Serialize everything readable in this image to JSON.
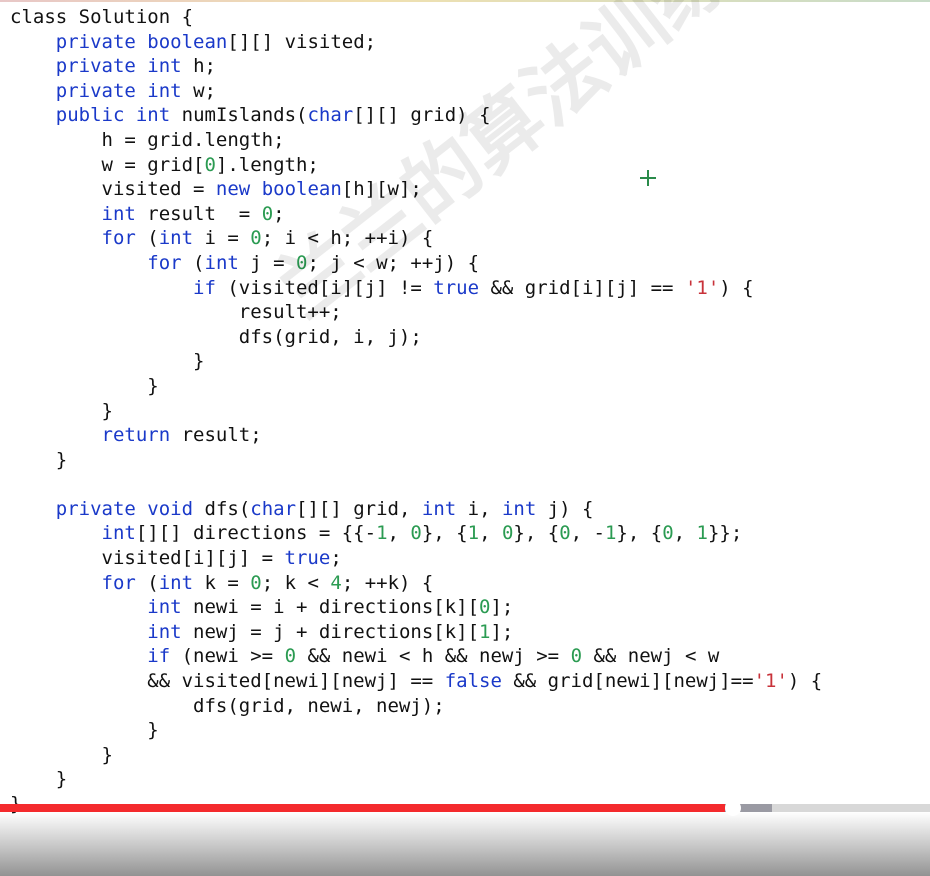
{
  "code_lines": [
    [
      {
        "t": "class Solution {",
        "c": "pl"
      }
    ],
    [
      {
        "t": "    ",
        "c": "pl"
      },
      {
        "t": "private",
        "c": "kw"
      },
      {
        "t": " ",
        "c": "pl"
      },
      {
        "t": "boolean",
        "c": "kw"
      },
      {
        "t": "[][] visited;",
        "c": "pl"
      }
    ],
    [
      {
        "t": "    ",
        "c": "pl"
      },
      {
        "t": "private",
        "c": "kw"
      },
      {
        "t": " ",
        "c": "pl"
      },
      {
        "t": "int",
        "c": "kw"
      },
      {
        "t": " h;",
        "c": "pl"
      }
    ],
    [
      {
        "t": "    ",
        "c": "pl"
      },
      {
        "t": "private",
        "c": "kw"
      },
      {
        "t": " ",
        "c": "pl"
      },
      {
        "t": "int",
        "c": "kw"
      },
      {
        "t": " w;",
        "c": "pl"
      }
    ],
    [
      {
        "t": "    ",
        "c": "pl"
      },
      {
        "t": "public",
        "c": "kw"
      },
      {
        "t": " ",
        "c": "pl"
      },
      {
        "t": "int",
        "c": "kw"
      },
      {
        "t": " numIslands(",
        "c": "pl"
      },
      {
        "t": "char",
        "c": "kw"
      },
      {
        "t": "[][] grid) {",
        "c": "pl"
      }
    ],
    [
      {
        "t": "        h = grid.length;",
        "c": "pl"
      }
    ],
    [
      {
        "t": "        w = grid[",
        "c": "pl"
      },
      {
        "t": "0",
        "c": "num"
      },
      {
        "t": "].length;",
        "c": "pl"
      }
    ],
    [
      {
        "t": "        visited = ",
        "c": "pl"
      },
      {
        "t": "new",
        "c": "kw"
      },
      {
        "t": " ",
        "c": "pl"
      },
      {
        "t": "boolean",
        "c": "kw"
      },
      {
        "t": "[h][w];",
        "c": "pl"
      }
    ],
    [
      {
        "t": "        ",
        "c": "pl"
      },
      {
        "t": "int",
        "c": "kw"
      },
      {
        "t": " result  = ",
        "c": "pl"
      },
      {
        "t": "0",
        "c": "num"
      },
      {
        "t": ";",
        "c": "pl"
      }
    ],
    [
      {
        "t": "        ",
        "c": "pl"
      },
      {
        "t": "for",
        "c": "kw"
      },
      {
        "t": " (",
        "c": "pl"
      },
      {
        "t": "int",
        "c": "kw"
      },
      {
        "t": " i = ",
        "c": "pl"
      },
      {
        "t": "0",
        "c": "num"
      },
      {
        "t": "; i < h; ++i) {",
        "c": "pl"
      }
    ],
    [
      {
        "t": "            ",
        "c": "pl"
      },
      {
        "t": "for",
        "c": "kw"
      },
      {
        "t": " (",
        "c": "pl"
      },
      {
        "t": "int",
        "c": "kw"
      },
      {
        "t": " j = ",
        "c": "pl"
      },
      {
        "t": "0",
        "c": "num"
      },
      {
        "t": "; j < w; ++j) {",
        "c": "pl"
      }
    ],
    [
      {
        "t": "                ",
        "c": "pl"
      },
      {
        "t": "if",
        "c": "kw"
      },
      {
        "t": " (visited[i][j] != ",
        "c": "pl"
      },
      {
        "t": "true",
        "c": "kw"
      },
      {
        "t": " && grid[i][j] == ",
        "c": "pl"
      },
      {
        "t": "'1'",
        "c": "str"
      },
      {
        "t": ") {",
        "c": "pl"
      }
    ],
    [
      {
        "t": "                    result++;",
        "c": "pl"
      }
    ],
    [
      {
        "t": "                    dfs(grid, i, j);",
        "c": "pl"
      }
    ],
    [
      {
        "t": "                }",
        "c": "pl"
      }
    ],
    [
      {
        "t": "            }",
        "c": "pl"
      }
    ],
    [
      {
        "t": "        }",
        "c": "pl"
      }
    ],
    [
      {
        "t": "        ",
        "c": "pl"
      },
      {
        "t": "return",
        "c": "kw"
      },
      {
        "t": " result;",
        "c": "pl"
      }
    ],
    [
      {
        "t": "    }",
        "c": "pl"
      }
    ],
    [
      {
        "t": "",
        "c": "pl"
      }
    ],
    [
      {
        "t": "    ",
        "c": "pl"
      },
      {
        "t": "private",
        "c": "kw"
      },
      {
        "t": " ",
        "c": "pl"
      },
      {
        "t": "void",
        "c": "kw"
      },
      {
        "t": " dfs(",
        "c": "pl"
      },
      {
        "t": "char",
        "c": "kw"
      },
      {
        "t": "[][] grid, ",
        "c": "pl"
      },
      {
        "t": "int",
        "c": "kw"
      },
      {
        "t": " i, ",
        "c": "pl"
      },
      {
        "t": "int",
        "c": "kw"
      },
      {
        "t": " j) {",
        "c": "pl"
      }
    ],
    [
      {
        "t": "        ",
        "c": "pl"
      },
      {
        "t": "int",
        "c": "kw"
      },
      {
        "t": "[][] directions = {{-",
        "c": "pl"
      },
      {
        "t": "1",
        "c": "num"
      },
      {
        "t": ", ",
        "c": "pl"
      },
      {
        "t": "0",
        "c": "num"
      },
      {
        "t": "}, {",
        "c": "pl"
      },
      {
        "t": "1",
        "c": "num"
      },
      {
        "t": ", ",
        "c": "pl"
      },
      {
        "t": "0",
        "c": "num"
      },
      {
        "t": "}, {",
        "c": "pl"
      },
      {
        "t": "0",
        "c": "num"
      },
      {
        "t": ", -",
        "c": "pl"
      },
      {
        "t": "1",
        "c": "num"
      },
      {
        "t": "}, {",
        "c": "pl"
      },
      {
        "t": "0",
        "c": "num"
      },
      {
        "t": ", ",
        "c": "pl"
      },
      {
        "t": "1",
        "c": "num"
      },
      {
        "t": "}};",
        "c": "pl"
      }
    ],
    [
      {
        "t": "        visited[i][j] = ",
        "c": "pl"
      },
      {
        "t": "true",
        "c": "kw"
      },
      {
        "t": ";",
        "c": "pl"
      }
    ],
    [
      {
        "t": "        ",
        "c": "pl"
      },
      {
        "t": "for",
        "c": "kw"
      },
      {
        "t": " (",
        "c": "pl"
      },
      {
        "t": "int",
        "c": "kw"
      },
      {
        "t": " k = ",
        "c": "pl"
      },
      {
        "t": "0",
        "c": "num"
      },
      {
        "t": "; k < ",
        "c": "pl"
      },
      {
        "t": "4",
        "c": "num"
      },
      {
        "t": "; ++k) {",
        "c": "pl"
      }
    ],
    [
      {
        "t": "            ",
        "c": "pl"
      },
      {
        "t": "int",
        "c": "kw"
      },
      {
        "t": " newi = i + directions[k][",
        "c": "pl"
      },
      {
        "t": "0",
        "c": "num"
      },
      {
        "t": "];",
        "c": "pl"
      }
    ],
    [
      {
        "t": "            ",
        "c": "pl"
      },
      {
        "t": "int",
        "c": "kw"
      },
      {
        "t": " newj = j + directions[k][",
        "c": "pl"
      },
      {
        "t": "1",
        "c": "num"
      },
      {
        "t": "];",
        "c": "pl"
      }
    ],
    [
      {
        "t": "            ",
        "c": "pl"
      },
      {
        "t": "if",
        "c": "kw"
      },
      {
        "t": " (newi >= ",
        "c": "pl"
      },
      {
        "t": "0",
        "c": "num"
      },
      {
        "t": " && newi < h && newj >= ",
        "c": "pl"
      },
      {
        "t": "0",
        "c": "num"
      },
      {
        "t": " && newj < w",
        "c": "pl"
      }
    ],
    [
      {
        "t": "            && visited[newi][newj] == ",
        "c": "pl"
      },
      {
        "t": "false",
        "c": "kw"
      },
      {
        "t": " && grid[newi][newj]==",
        "c": "pl"
      },
      {
        "t": "'1'",
        "c": "str"
      },
      {
        "t": ") {",
        "c": "pl"
      }
    ],
    [
      {
        "t": "                dfs(grid, newi, newj);",
        "c": "pl"
      }
    ],
    [
      {
        "t": "            }",
        "c": "pl"
      }
    ],
    [
      {
        "t": "        }",
        "c": "pl"
      }
    ],
    [
      {
        "t": "    }",
        "c": "pl"
      }
    ],
    [
      {
        "t": "}",
        "c": "pl"
      }
    ]
  ],
  "watermark": "兰兰的算法训练营",
  "video": {
    "progress": 0.78,
    "buffered": 0.83
  },
  "colors": {
    "keyword": "#1a39c9",
    "number": "#2b9b52",
    "string": "#c8323a",
    "progress_fill": "#f42a2d"
  }
}
